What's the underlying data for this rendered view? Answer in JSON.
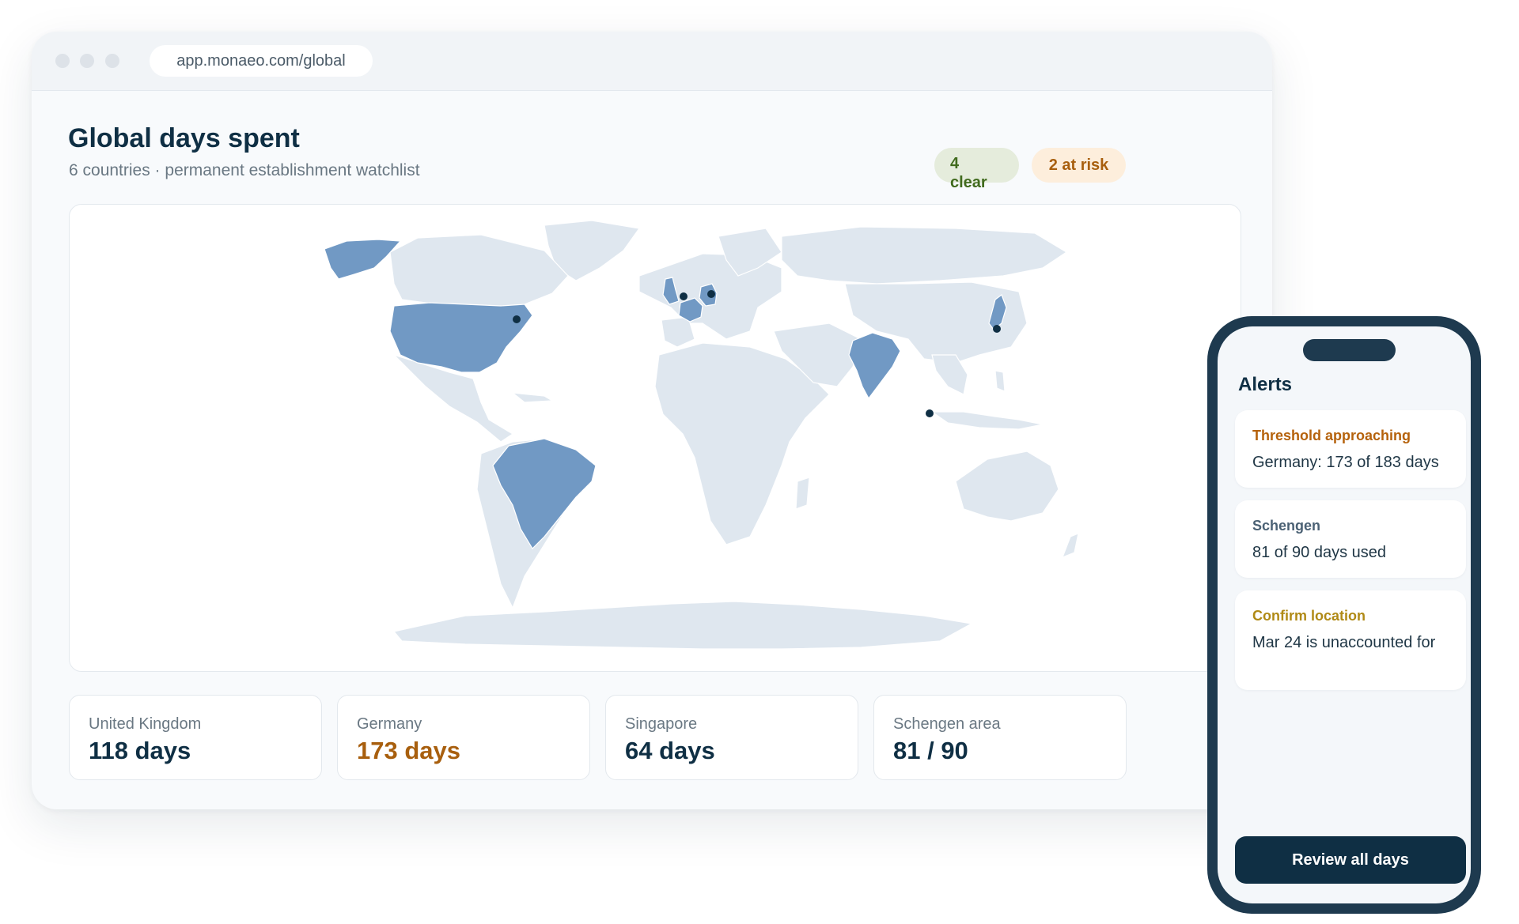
{
  "browser": {
    "url": "app.monaeo.com/global"
  },
  "header": {
    "title": "Global days spent",
    "subtitle": "6 countries · permanent establishment watchlist",
    "badges": {
      "clear_count": "4",
      "clear_label": "clear",
      "at_risk": "2 at risk"
    }
  },
  "map": {
    "land_color": "#dfe7ef",
    "highlight_color": "#7199c4",
    "marker_color": "#0f2f44",
    "highlighted_countries": [
      "United States",
      "Brazil",
      "United Kingdom",
      "France",
      "Germany",
      "India",
      "Japan"
    ]
  },
  "stats": [
    {
      "label": "United Kingdom",
      "value": "118 days",
      "status": "normal"
    },
    {
      "label": "Germany",
      "value": "173 days",
      "status": "warning"
    },
    {
      "label": "Singapore",
      "value": "64 days",
      "status": "normal"
    },
    {
      "label": "Schengen area",
      "value": "81 / 90",
      "status": "normal"
    }
  ],
  "phone": {
    "title": "Alerts",
    "alerts": [
      {
        "heading": "Threshold approaching",
        "body": "Germany: 173 of 183 days",
        "tone": "#b5620c"
      },
      {
        "heading": "Schengen",
        "body": "81 of 90 days used",
        "tone": "#4b6174"
      },
      {
        "heading": "Confirm location",
        "body": "Mar 24 is unaccounted for",
        "tone": "#b08a16"
      }
    ],
    "cta": "Review all days"
  }
}
